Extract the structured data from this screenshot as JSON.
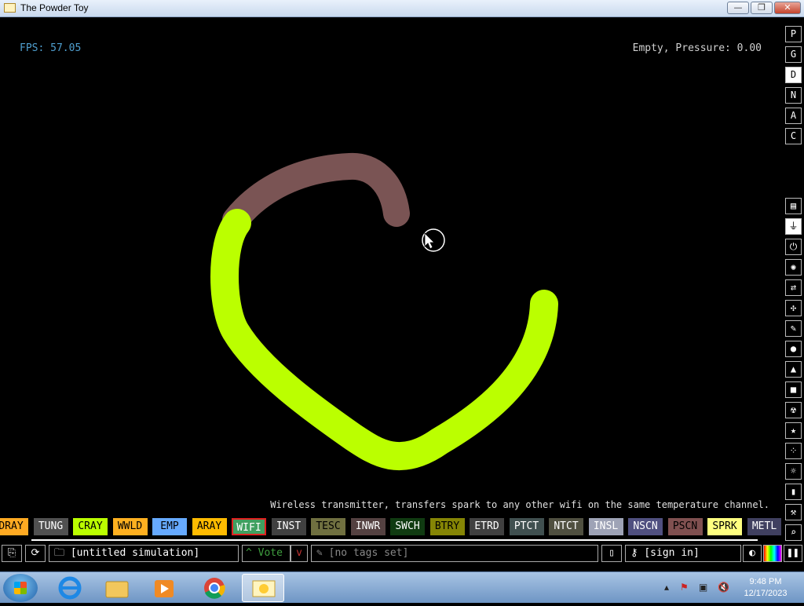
{
  "window": {
    "title": "The Powder Toy",
    "min": "—",
    "max": "❐",
    "close": "✕"
  },
  "hud": {
    "fps": "FPS: 57.05",
    "status": "Empty, Pressure: 0.00"
  },
  "right_toolbar_top": [
    "P",
    "G",
    "D",
    "N",
    "A",
    "C"
  ],
  "right_toolbar_top_selected": "D",
  "right_toolbar_categories": [
    "walls",
    "electronics",
    "powered",
    "explosives",
    "sensors",
    "force",
    "gases",
    "liquids",
    "powders",
    "solids",
    "radioactive",
    "special",
    "life",
    "tools",
    "favorites",
    "decoration",
    "search"
  ],
  "element_description": "Wireless transmitter, transfers spark to any other wifi on the same temperature channel.",
  "elements": [
    {
      "name": "DRAY",
      "bg": "#ffaa22",
      "fg": "#000000"
    },
    {
      "name": "TUNG",
      "bg": "#505050",
      "fg": "#ffffff"
    },
    {
      "name": "CRAY",
      "bg": "#bbff00",
      "fg": "#000000"
    },
    {
      "name": "WWLD",
      "bg": "#ffb020",
      "fg": "#000000"
    },
    {
      "name": "EMP",
      "bg": "#66aaff",
      "fg": "#000000"
    },
    {
      "name": "ARAY",
      "bg": "#ffbb00",
      "fg": "#000000"
    },
    {
      "name": "WIFI",
      "bg": "#40a060",
      "fg": "#ffffff"
    },
    {
      "name": "INST",
      "bg": "#404040",
      "fg": "#ffffff"
    },
    {
      "name": "TESC",
      "bg": "#707040",
      "fg": "#000000"
    },
    {
      "name": "INWR",
      "bg": "#544141",
      "fg": "#ffffff"
    },
    {
      "name": "SWCH",
      "bg": "#103b11",
      "fg": "#ffffff"
    },
    {
      "name": "BTRY",
      "bg": "#858505",
      "fg": "#000000"
    },
    {
      "name": "ETRD",
      "bg": "#404040",
      "fg": "#ffffff"
    },
    {
      "name": "PTCT",
      "bg": "#405050",
      "fg": "#ffffff"
    },
    {
      "name": "NTCT",
      "bg": "#505040",
      "fg": "#ffffff"
    },
    {
      "name": "INSL",
      "bg": "#9ea3b6",
      "fg": "#ffffff"
    },
    {
      "name": "NSCN",
      "bg": "#505080",
      "fg": "#ffffff"
    },
    {
      "name": "PSCN",
      "bg": "#805050",
      "fg": "#000000"
    },
    {
      "name": "SPRK",
      "bg": "#ffff80",
      "fg": "#000000"
    },
    {
      "name": "METL",
      "bg": "#404060",
      "fg": "#ffffff"
    }
  ],
  "selected_element": "WIFI",
  "bottom": {
    "simulation_name": "[untitled simulation]",
    "vote": "Vote",
    "tags": "[no tags set]",
    "sign_in": "[sign in]"
  },
  "taskbar": {
    "time": "9:48 PM",
    "date": "12/17/2023"
  },
  "colors": {
    "wifi_drawn": "#bbff00",
    "inwr_drawn": "#7a5454",
    "fps": "#4f9fcf"
  }
}
